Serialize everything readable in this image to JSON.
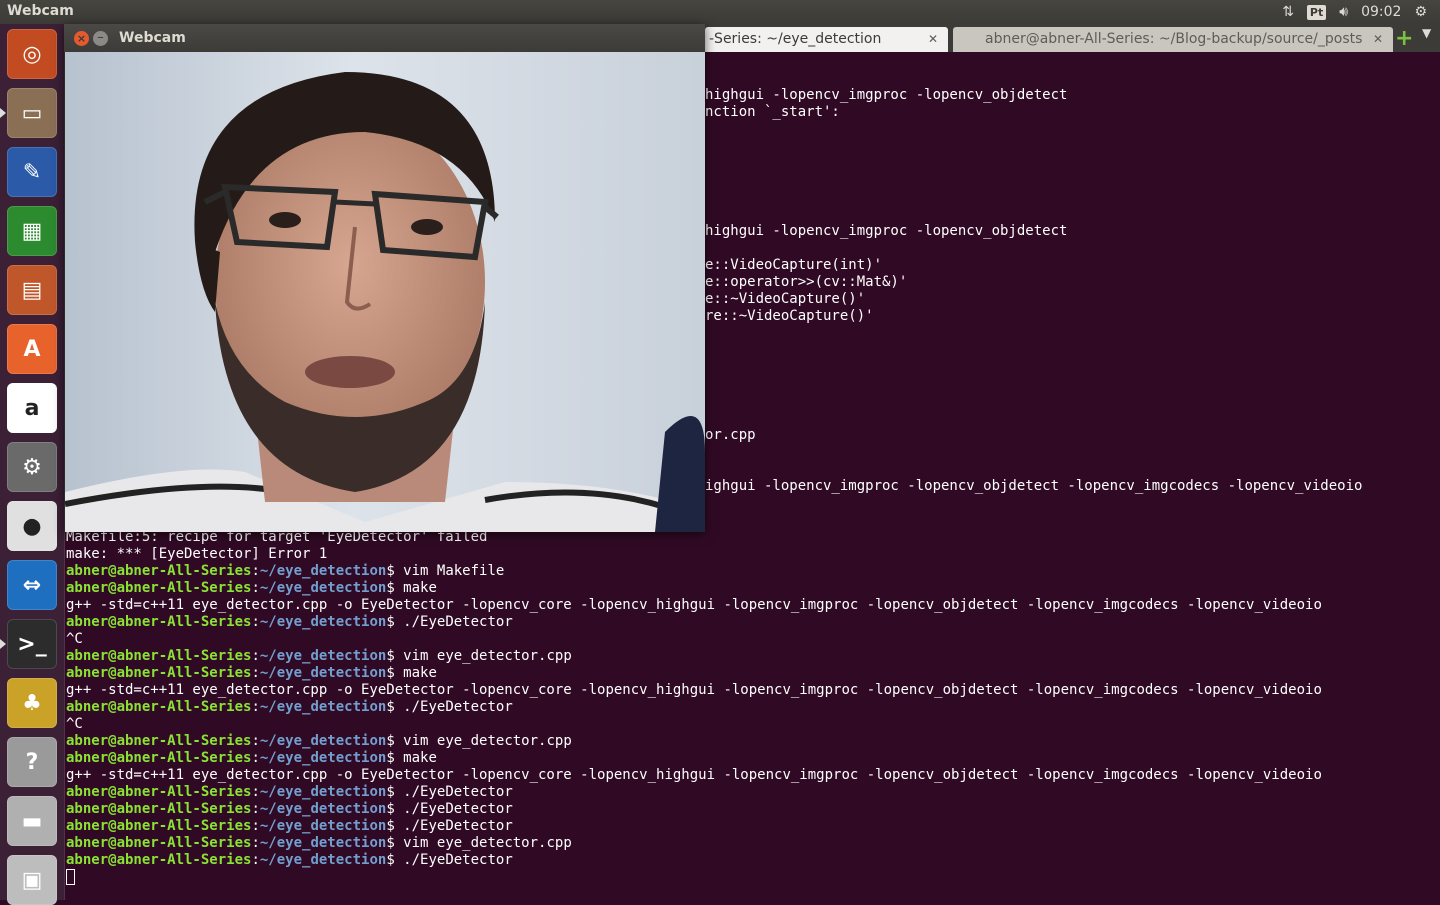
{
  "top_panel": {
    "app_title": "Webcam",
    "keyboard_layout": "Pt",
    "clock": "09:02"
  },
  "launcher": {
    "items": [
      {
        "name": "ubuntu-dash",
        "color": "#c24b22"
      },
      {
        "name": "files",
        "color": "#8a6f55"
      },
      {
        "name": "libreoffice-writer",
        "color": "#2a5aa8"
      },
      {
        "name": "libreoffice-calc",
        "color": "#2c8a2f"
      },
      {
        "name": "libreoffice-impress",
        "color": "#c0572a"
      },
      {
        "name": "ubuntu-software",
        "color": "#e8622c"
      },
      {
        "name": "amazon",
        "color": "#ffffff"
      },
      {
        "name": "system-settings",
        "color": "#6a6a6a"
      },
      {
        "name": "chrome",
        "color": "#e0e0e0"
      },
      {
        "name": "teamviewer",
        "color": "#1f6fc1"
      },
      {
        "name": "terminal",
        "color": "#2c2c2c"
      },
      {
        "name": "gnome-sudoku-teapot",
        "color": "#c9a227"
      },
      {
        "name": "help",
        "color": "#9a9a9a"
      },
      {
        "name": "disk",
        "color": "#b0b0b0"
      },
      {
        "name": "trash-printer",
        "color": "#bdbdbd"
      }
    ]
  },
  "terminal_tabs": [
    {
      "label": "-Series: ~/eye_detection",
      "active": true
    },
    {
      "label": "abner@abner-All-Series: ~/Blog-backup/source/_posts",
      "active": false
    }
  ],
  "webcam_window": {
    "title": "Webcam"
  },
  "terminal": {
    "prompt_user": "abner@abner-All-Series",
    "prompt_path": "~/eye_detection",
    "partial_lines": [
      "highgui -lopencv_imgproc -lopencv_objdetect",
      "nction `_start':",
      "highgui -lopencv_imgproc -lopencv_objdetect",
      "e::VideoCapture(int)'",
      "e::operator>>(cv::Mat&)'",
      "e::~VideoCapture()'",
      "re::~VideoCapture()'",
      "or.cpp",
      "ighgui -lopencv_imgproc -lopencv_objdetect -lopencv_imgcodecs -lopencv_videoio"
    ],
    "lines": [
      {
        "kind": "out",
        "text": "Makefile:5: recipe for target 'EyeDetector' failed"
      },
      {
        "kind": "out",
        "text": "make: *** [EyeDetector] Error 1"
      },
      {
        "kind": "cmd",
        "text": "vim Makefile"
      },
      {
        "kind": "cmd",
        "text": "make"
      },
      {
        "kind": "out",
        "text": "g++ -std=c++11 eye_detector.cpp -o EyeDetector -lopencv_core -lopencv_highgui -lopencv_imgproc -lopencv_objdetect -lopencv_imgcodecs -lopencv_videoio"
      },
      {
        "kind": "cmd",
        "text": "./EyeDetector"
      },
      {
        "kind": "out",
        "text": "^C"
      },
      {
        "kind": "cmd",
        "text": "vim eye_detector.cpp"
      },
      {
        "kind": "cmd",
        "text": "make"
      },
      {
        "kind": "out",
        "text": "g++ -std=c++11 eye_detector.cpp -o EyeDetector -lopencv_core -lopencv_highgui -lopencv_imgproc -lopencv_objdetect -lopencv_imgcodecs -lopencv_videoio"
      },
      {
        "kind": "cmd",
        "text": "./EyeDetector"
      },
      {
        "kind": "out",
        "text": "^C"
      },
      {
        "kind": "cmd",
        "text": "vim eye_detector.cpp"
      },
      {
        "kind": "cmd",
        "text": "make"
      },
      {
        "kind": "out",
        "text": "g++ -std=c++11 eye_detector.cpp -o EyeDetector -lopencv_core -lopencv_highgui -lopencv_imgproc -lopencv_objdetect -lopencv_imgcodecs -lopencv_videoio"
      },
      {
        "kind": "cmd",
        "text": "./EyeDetector"
      },
      {
        "kind": "cmd",
        "text": "./EyeDetector"
      },
      {
        "kind": "cmd",
        "text": "./EyeDetector"
      },
      {
        "kind": "cmd",
        "text": "vim eye_detector.cpp"
      },
      {
        "kind": "cmd",
        "text": "./EyeDetector"
      }
    ]
  }
}
